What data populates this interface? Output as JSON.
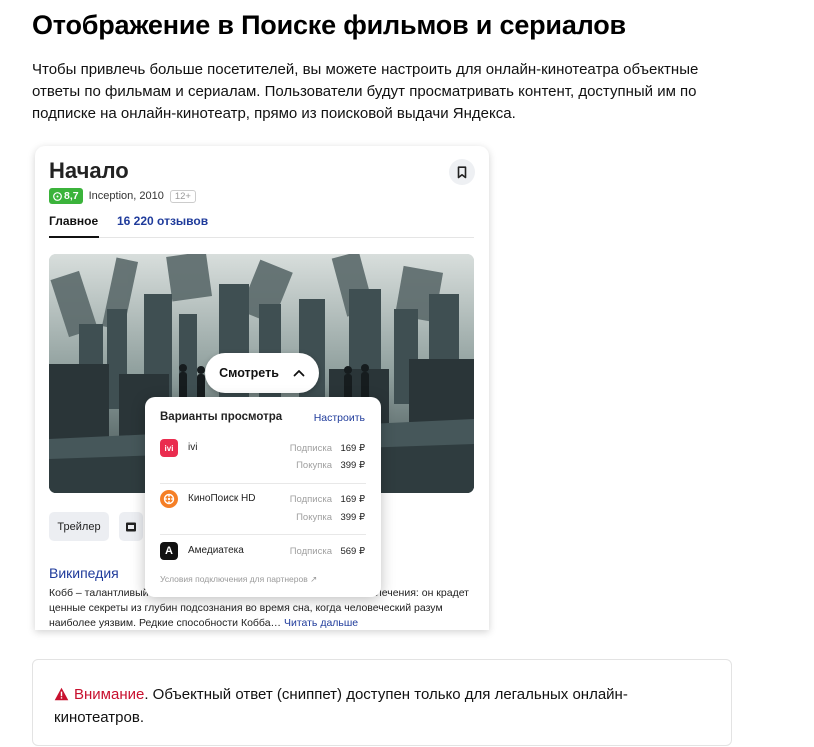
{
  "page": {
    "title": "Отображение в Поиске фильмов и сериалов",
    "intro": "Чтобы привлечь больше посетителей, вы можете настроить для онлайн-кинотеатра объектные ответы по фильмам и сериалам. Пользователи будут просматривать контент, доступный им по подписке на онлайн-кинотеатр, прямо из поисковой выдачи Яндекса."
  },
  "snippet": {
    "title": "Начало",
    "rating": "8,7",
    "meta": "Inception, 2010",
    "age": "12+",
    "tabs": {
      "main": "Главное",
      "reviews": "16 220 отзывов"
    },
    "watch_label": "Смотреть",
    "chip_trailer": "Трейлер",
    "wiki": {
      "title": "Википедия",
      "text_start": "Кобб – талантливый",
      "text_end": "лечения: он крадет",
      "text_rest": "ценные секреты из глубин подсознания во время сна, когда человеческий разум наиболее уязвим. Редкие способности Кобба…",
      "more": "Читать дальше"
    }
  },
  "popup": {
    "title": "Варианты просмотра",
    "setup_link": "Настроить",
    "providers": [
      {
        "name": "ivi",
        "logo_text": "ivi",
        "logo_color": "#ea2c4f",
        "prices": [
          {
            "label": "Подписка",
            "value": "169 ₽"
          },
          {
            "label": "Покупка",
            "value": "399 ₽"
          }
        ]
      },
      {
        "name": "КиноПоиск HD",
        "logo_color": "#f57f26",
        "prices": [
          {
            "label": "Подписка",
            "value": "169 ₽"
          },
          {
            "label": "Покупка",
            "value": "399 ₽"
          }
        ]
      },
      {
        "name": "Амедиатека",
        "logo_text": "A",
        "logo_color": "#111111",
        "prices": [
          {
            "label": "Подписка",
            "value": "569 ₽"
          }
        ]
      }
    ],
    "footer": "Условия подключения для партнеров ↗"
  },
  "notice": {
    "label": "Внимание",
    "text": ". Объектный ответ (сниппет) доступен только для легальных онлайн-кинотеатров."
  },
  "colors": {
    "link": "#1f3b9b",
    "rating_green": "#3bb33b",
    "warning_red": "#c8102e"
  }
}
